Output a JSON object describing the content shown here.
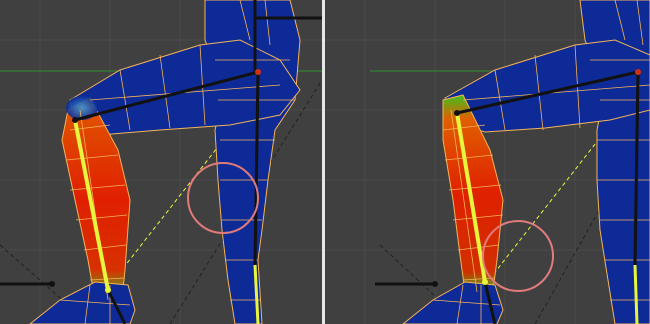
{
  "colors": {
    "background": "#404040",
    "grid_line": "#4a4a4a",
    "horizon_green": "#2f8f2f",
    "mesh_blue": "#0d2a96",
    "wire_orange": "#f5b35a",
    "bone_black": "#111111",
    "bone_selected": "#e8f53a",
    "highlight_circle": "#e07b7b",
    "divider": "#e6e6e6"
  },
  "viewports": [
    {
      "id": "left",
      "mode": "weight-paint",
      "selected_bone": "shin"
    },
    {
      "id": "right",
      "mode": "weight-paint",
      "selected_bone": "shin"
    }
  ]
}
